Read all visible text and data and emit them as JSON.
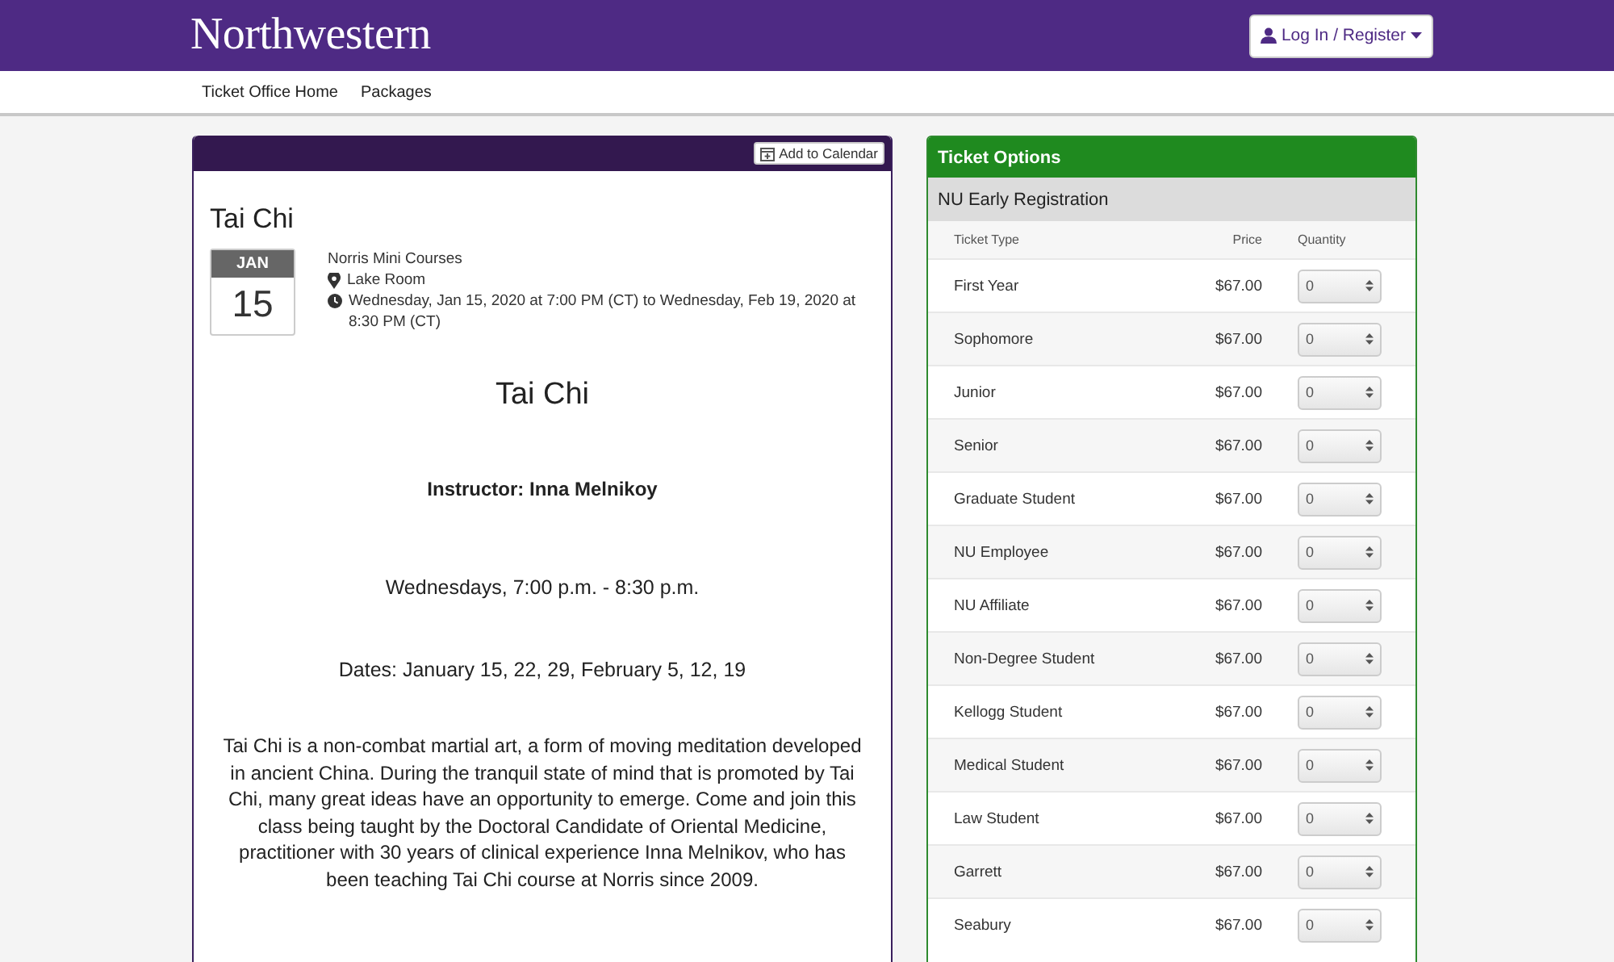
{
  "header": {
    "logo": "Northwestern",
    "login_button": "Log In / Register"
  },
  "nav": [
    "Ticket Office Home",
    "Packages"
  ],
  "event": {
    "calendar_button": "Add to Calendar",
    "title": "Tai Chi",
    "date_month": "JAN",
    "date_day": "15",
    "organizer": "Norris Mini Courses",
    "location": "Lake Room",
    "time": "Wednesday, Jan 15, 2020 at 7:00 PM (CT) to Wednesday, Feb 19, 2020 at 8:30 PM (CT)",
    "description": [
      {
        "kind": "heading",
        "text": "Tai Chi"
      },
      {
        "kind": "subheading",
        "text": "Instructor: Inna Melnikoy"
      },
      {
        "kind": "line",
        "text": "Wednesdays, 7:00 p.m. - 8:30 p.m."
      },
      {
        "kind": "line",
        "text": "Dates: January 15, 22, 29, February 5, 12, 19"
      },
      {
        "kind": "paragraph",
        "text": "Tai Chi is a non-combat martial art, a form of moving meditation developed in ancient China. During the tranquil state of mind that is promoted by Tai Chi, many great ideas have an opportunity to emerge. Come and join this class being taught by the Doctoral Candidate of Oriental Medicine, practitioner with 30 years of clinical experience Inna Melnikov, who has been teaching Tai Chi course at Norris since 2009."
      }
    ]
  },
  "tickets": {
    "title": "Ticket Options",
    "group": "NU Early Registration",
    "columns": [
      "Ticket Type",
      "Price",
      "Quantity"
    ],
    "rows": [
      {
        "type": "First Year",
        "price": "$67.00",
        "quantity": "0"
      },
      {
        "type": "Sophomore",
        "price": "$67.00",
        "quantity": "0"
      },
      {
        "type": "Junior",
        "price": "$67.00",
        "quantity": "0"
      },
      {
        "type": "Senior",
        "price": "$67.00",
        "quantity": "0"
      },
      {
        "type": "Graduate Student",
        "price": "$67.00",
        "quantity": "0"
      },
      {
        "type": "NU Employee",
        "price": "$67.00",
        "quantity": "0"
      },
      {
        "type": "NU Affiliate",
        "price": "$67.00",
        "quantity": "0"
      },
      {
        "type": "Non-Degree Student",
        "price": "$67.00",
        "quantity": "0"
      },
      {
        "type": "Kellogg Student",
        "price": "$67.00",
        "quantity": "0"
      },
      {
        "type": "Medical Student",
        "price": "$67.00",
        "quantity": "0"
      },
      {
        "type": "Law Student",
        "price": "$67.00",
        "quantity": "0"
      },
      {
        "type": "Garrett",
        "price": "$67.00",
        "quantity": "0"
      },
      {
        "type": "Seabury",
        "price": "$67.00",
        "quantity": "0"
      }
    ]
  }
}
